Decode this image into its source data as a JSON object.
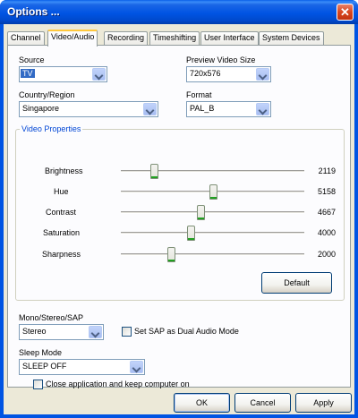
{
  "window": {
    "title": "Options ...",
    "close_glyph": "✕"
  },
  "tabs": [
    "Channel",
    "Video/Audio",
    "Recording",
    "Timeshifting",
    "User Interface",
    "System Devices"
  ],
  "active_tab": "Video/Audio",
  "source": {
    "label": "Source",
    "value": "TV"
  },
  "preview_size": {
    "label": "Preview Video Size",
    "value": "720x576"
  },
  "country": {
    "label": "Country/Region",
    "value": "Singapore"
  },
  "format": {
    "label": "Format",
    "value": "PAL_B"
  },
  "video_properties": {
    "title": "Video Properties",
    "sliders": [
      {
        "label": "Brightness",
        "value": "2119",
        "fraction": 0.17
      },
      {
        "label": "Hue",
        "value": "5158",
        "fraction": 0.51
      },
      {
        "label": "Contrast",
        "value": "4667",
        "fraction": 0.44
      },
      {
        "label": "Saturation",
        "value": "4000",
        "fraction": 0.38
      },
      {
        "label": "Sharpness",
        "value": "2000",
        "fraction": 0.27
      }
    ],
    "default_button": "Default"
  },
  "audio": {
    "label": "Mono/Stereo/SAP",
    "value": "Stereo",
    "sap_checkbox": "Set SAP as Dual Audio Mode",
    "sap_checked": false
  },
  "sleep": {
    "label": "Sleep Mode",
    "value": "SLEEP OFF",
    "keep_on_checkbox": "Close application and keep computer on",
    "keep_on_checked": false
  },
  "buttons": {
    "ok": "OK",
    "cancel": "Cancel",
    "apply": "Apply"
  },
  "colors": {
    "title_bar": "#0054e3",
    "dialog_bg": "#ece9d8",
    "group_title": "#0046d5",
    "slider_accent": "#21a121"
  }
}
